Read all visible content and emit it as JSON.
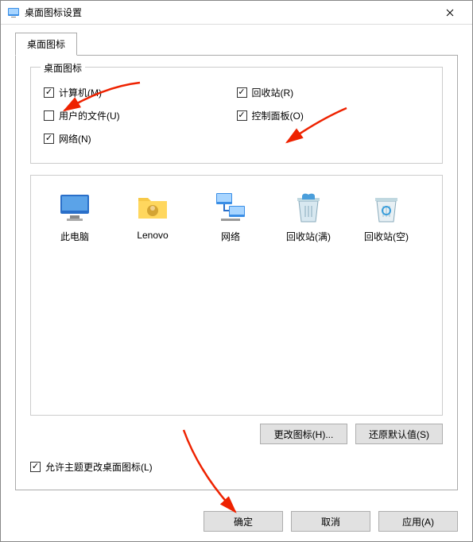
{
  "title": "桌面图标设置",
  "tab": {
    "label": "桌面图标"
  },
  "fieldset": {
    "legend": "桌面图标"
  },
  "checks": {
    "computer": {
      "label": "计算机(M)",
      "checked": true
    },
    "recyclebin": {
      "label": "回收站(R)",
      "checked": true
    },
    "userfiles": {
      "label": "用户的文件(U)",
      "checked": false
    },
    "controlpanel": {
      "label": "控制面板(O)",
      "checked": true
    },
    "network": {
      "label": "网络(N)",
      "checked": true
    }
  },
  "icons": {
    "thispc": "此电脑",
    "lenovo": "Lenovo",
    "network": "网络",
    "recyclefull": "回收站(满)",
    "recycleempty": "回收站(空)"
  },
  "buttons": {
    "changeicon": "更改图标(H)...",
    "restoredefault": "还原默认值(S)"
  },
  "allowtheme": {
    "label": "允许主题更改桌面图标(L)",
    "checked": true
  },
  "footer": {
    "ok": "确定",
    "cancel": "取消",
    "apply": "应用(A)"
  }
}
